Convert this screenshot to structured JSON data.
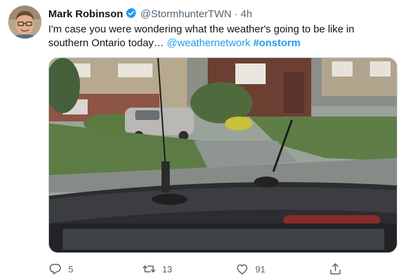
{
  "tweet": {
    "author_name": "Mark Robinson",
    "handle": "@StormhunterTWN",
    "separator": "·",
    "time": "4h",
    "text_main": "I'm case you were wondering what the weather's going to be like in southern Ontario today… ",
    "mention": "@weathernetwork",
    "hashtag": "#onstorm"
  },
  "actions": {
    "replies": "5",
    "retweets": "13",
    "likes": "91"
  },
  "colors": {
    "link": "#1d9bf0",
    "secondary_text": "#536471",
    "verified_badge": "#1d9bf0"
  },
  "icons": {
    "verified": "verified-badge-icon",
    "reply": "reply-icon",
    "retweet": "retweet-icon",
    "like": "heart-icon",
    "share": "share-icon"
  }
}
